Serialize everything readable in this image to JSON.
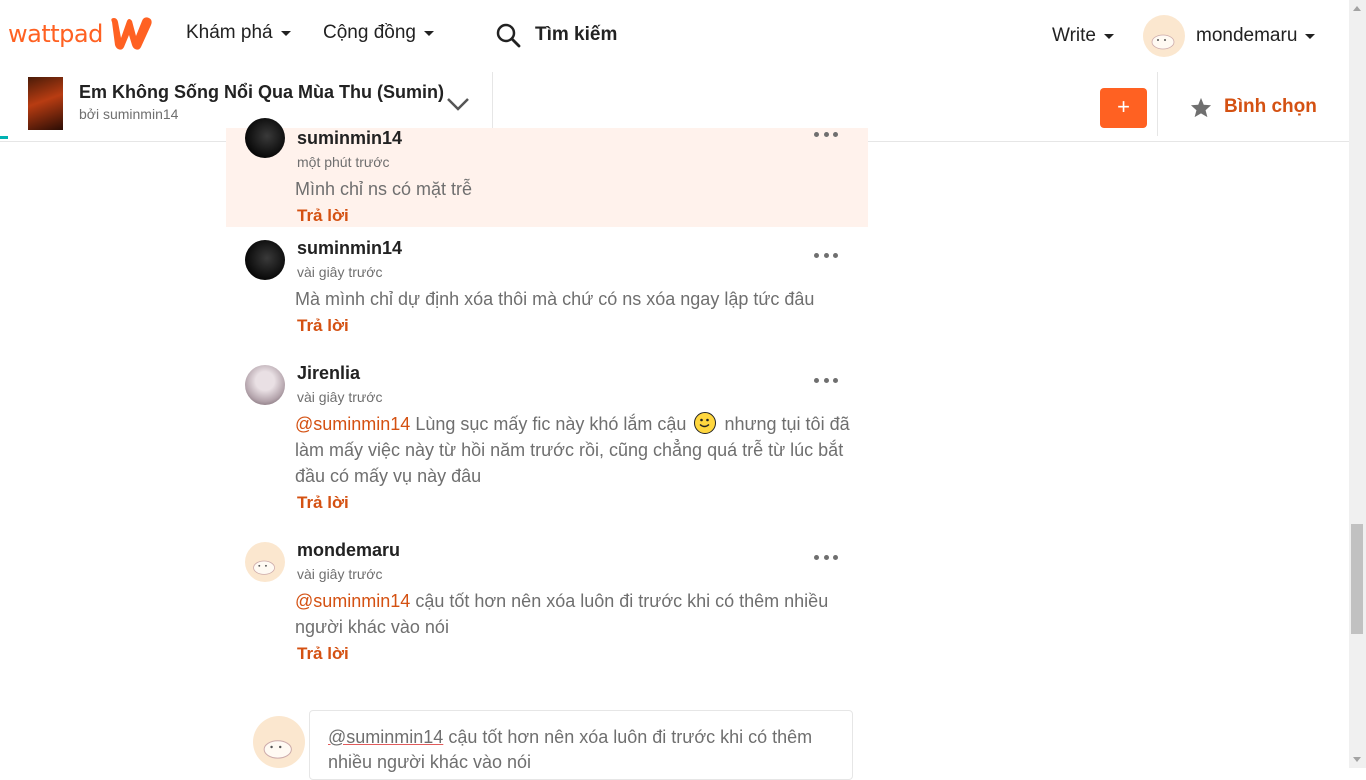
{
  "brand": {
    "logo_text": "wattpad",
    "accent": "#ff6122"
  },
  "nav": {
    "discover": "Khám phá",
    "community": "Cộng đồng",
    "search_label": "Tìm kiếm",
    "write": "Write",
    "username": "mondemaru"
  },
  "story": {
    "title": "Em Không Sống Nổi Qua Mùa Thu (Sumin)",
    "author": "bởi suminmin14",
    "add_label": "+",
    "vote_label": "Bình chọn"
  },
  "comments": [
    {
      "name": "suminmin14",
      "time": "một phút trước",
      "text": "Mình chỉ ns có mặt trễ",
      "reply": "Trả lời",
      "highlighted": true
    },
    {
      "name": "suminmin14",
      "time": "vài giây trước",
      "text": "Mà mình chỉ dự định xóa thôi mà chứ có ns xóa ngay lập tức đâu",
      "reply": "Trả lời"
    },
    {
      "name": "Jirenlia",
      "time": "vài giây trước",
      "mention": "@suminmin14",
      "text_a": " Lùng sục mấy fic này khó lắm cậu ",
      "text_b": " nhưng tụi tôi đã làm mấy việc này từ hồi năm trước rồi, cũng chẳng quá trễ từ lúc bắt đầu có mấy vụ này đâu",
      "reply": "Trả lời"
    },
    {
      "name": "mondemaru",
      "time": "vài giây trước",
      "mention": "@suminmin14",
      "text": " cậu tốt hơn nên xóa luôn đi trước khi có thêm nhiều người khác vào nói",
      "reply": "Trả lời"
    }
  ],
  "composer": {
    "mention": "@suminmin14",
    "text": " cậu tốt hơn nên xóa luôn đi trước khi có thêm nhiều người khác vào nói"
  }
}
